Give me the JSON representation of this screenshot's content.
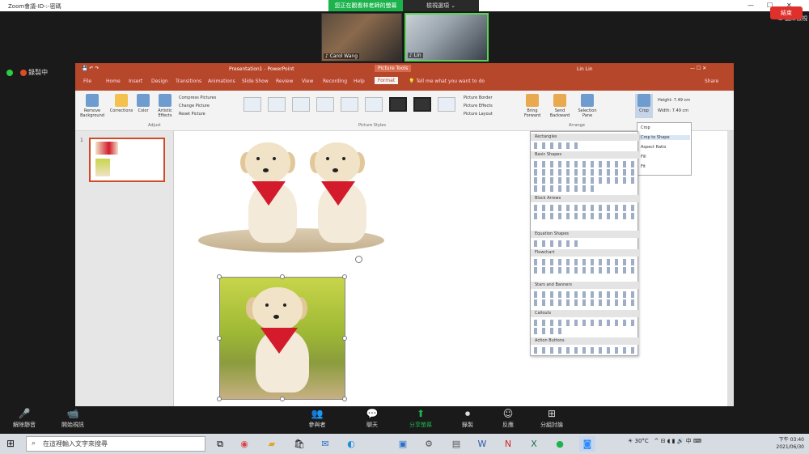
{
  "zoom": {
    "window_title": "Zoom會議-ID-:-密碼",
    "share_banner": "您正在觀看林老師的螢幕",
    "view_option": "檢視選項 ⌄",
    "gallery_label": "圖庫檢視",
    "participants": [
      {
        "name": "♪ Carol Wang"
      },
      {
        "name": "♪ Lin"
      }
    ],
    "recording_label": "錄製中",
    "toolbar": [
      {
        "icon": "microphone-muted-icon",
        "glyph": "🎤",
        "label": "解除靜音"
      },
      {
        "icon": "video-off-icon",
        "glyph": "📹",
        "label": "開始視訊"
      },
      {
        "icon": "participants-icon",
        "glyph": "👥",
        "label": "參與者"
      },
      {
        "icon": "chat-icon",
        "glyph": "💬",
        "label": "聊天"
      },
      {
        "icon": "share-screen-icon",
        "glyph": "⬆",
        "label": "分享螢幕"
      },
      {
        "icon": "record-icon",
        "glyph": "⏺",
        "label": "錄製"
      },
      {
        "icon": "reactions-icon",
        "glyph": "☺",
        "label": "反應"
      },
      {
        "icon": "breakout-rooms-icon",
        "glyph": "⊞",
        "label": "分組討論"
      }
    ],
    "end_label": "結束"
  },
  "powerpoint": {
    "title": "Presentation1 - PowerPoint",
    "picture_tools": "Picture Tools",
    "user": "Lin Lin",
    "tabs": [
      "File",
      "Home",
      "Insert",
      "Design",
      "Transitions",
      "Animations",
      "Slide Show",
      "Review",
      "View",
      "Recording",
      "Help",
      "Format"
    ],
    "tell_me": "Tell me what you want to do",
    "share": "Share",
    "ribbon": {
      "remove_background": "Remove Background",
      "corrections": "Corrections",
      "color": "Color",
      "artistic_effects": "Artistic Effects",
      "compress": "Compress Pictures",
      "change": "Change Picture",
      "reset": "Reset Picture",
      "adjust_label": "Adjust",
      "styles_label": "Picture Styles",
      "border": "Picture Border",
      "effects": "Picture Effects",
      "layout": "Picture Layout",
      "bring_forward": "Bring Forward",
      "send_backward": "Send Backward",
      "selection_pane": "Selection Pane",
      "arrange_label": "Arrange",
      "crop": "Crop",
      "height": "Height: 7.49 cm",
      "width": "Width: 7.49 cm"
    },
    "slide_number": "1",
    "shapes_menu": {
      "sections": [
        "Rectangles",
        "Basic Shapes",
        "Block Arrows",
        "Equation Shapes",
        "Flowchart",
        "Stars and Banners",
        "Callouts",
        "Action Buttons"
      ]
    },
    "crop_menu": {
      "items": [
        "Crop",
        "Crop to Shape",
        "Aspect Ratio",
        "Fill",
        "Fit"
      ]
    }
  },
  "taskbar": {
    "search_placeholder": "在這裡輸入文字來搜尋",
    "tray_text": "30°C",
    "time": "下午 03:40",
    "date": "2021/06/30"
  }
}
